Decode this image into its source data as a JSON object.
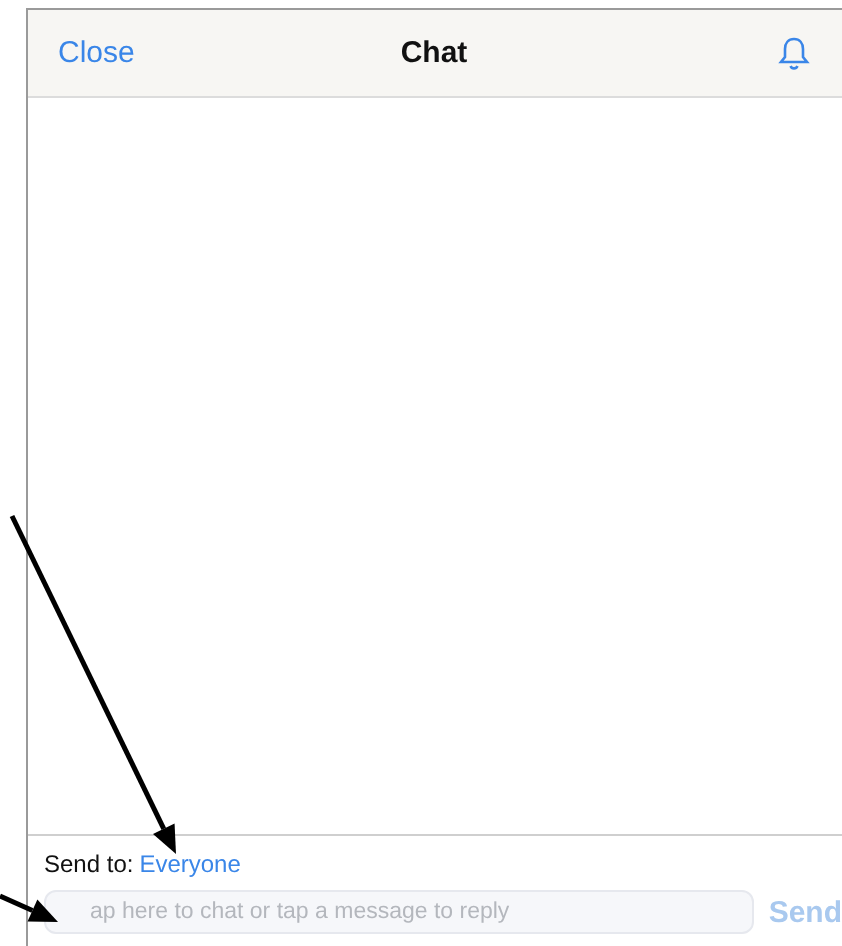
{
  "header": {
    "close": "Close",
    "title": "Chat"
  },
  "footer": {
    "send_to_label": "Send to:",
    "recipient": "Everyone",
    "message": {
      "placeholder": "ap here to chat or tap a message to reply"
    },
    "send": {
      "label": "Send",
      "disabled": true
    }
  }
}
